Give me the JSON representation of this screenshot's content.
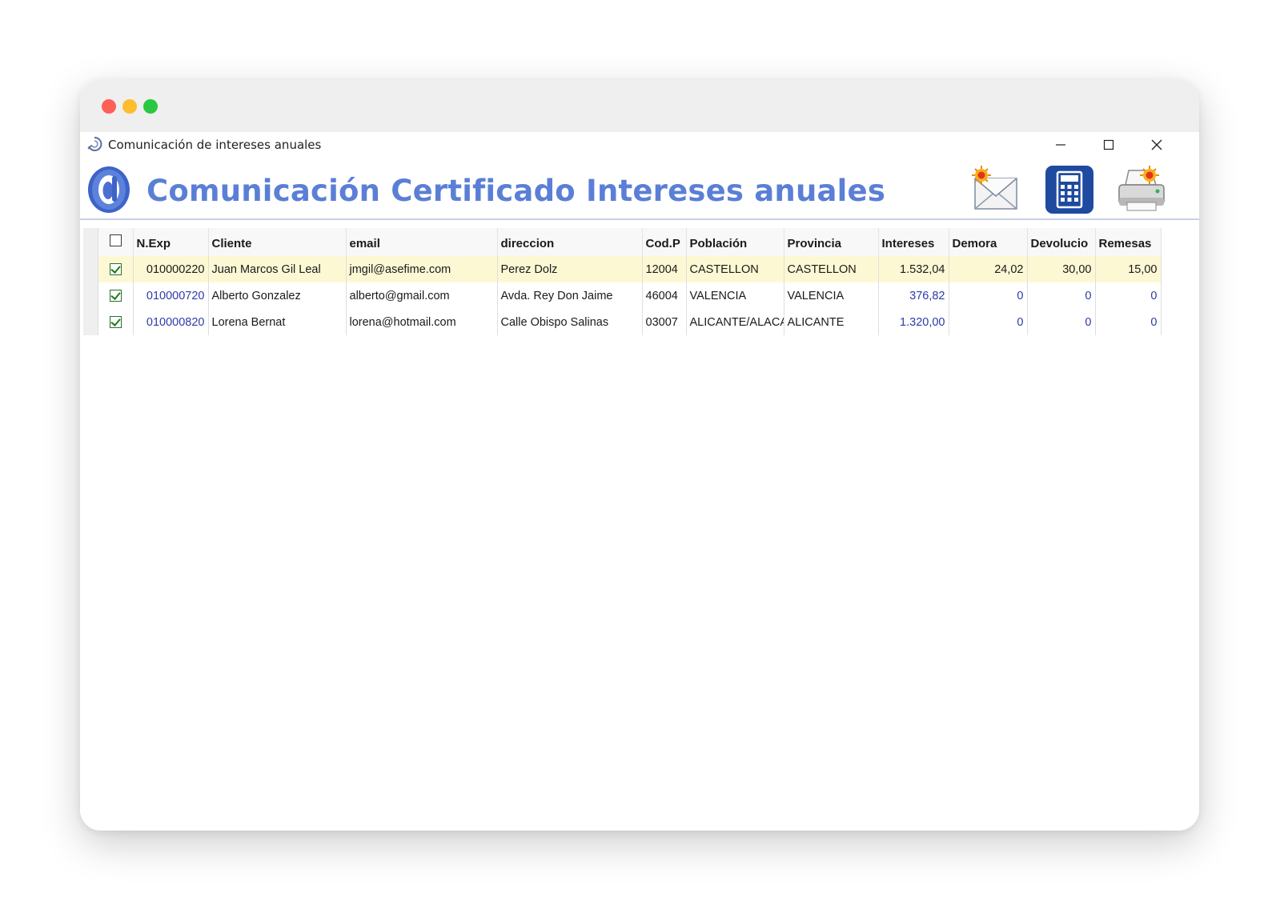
{
  "window": {
    "title": "Comunicación de intereses anuales",
    "heading": "Comunicación Certificado Intereses anuales",
    "minimize_label": "Minimizar",
    "maximize_label": "Maximizar",
    "close_label": "Cerrar"
  },
  "toolbar": {
    "items": [
      {
        "icon": "envelope-send-icon"
      },
      {
        "icon": "calculator-icon"
      },
      {
        "icon": "printer-icon"
      }
    ]
  },
  "colors": {
    "heading": "#5b7fd6",
    "accent_blue": "#1e4aa0",
    "selected_row": "#fdf8d4",
    "link_value": "#2d3ba8"
  },
  "grid": {
    "header_checkbox_checked": false,
    "columns": [
      "N.Exp",
      "Cliente",
      "email",
      "direccion",
      "Cod.P",
      "Población",
      "Provincia",
      "Intereses",
      "Demora",
      "Devolucio",
      "Remesas"
    ],
    "rows": [
      {
        "checked": true,
        "selected": true,
        "cells": [
          "010000220",
          "Juan Marcos Gil Leal",
          "jmgil@asefime.com",
          "Perez Dolz",
          "12004",
          "CASTELLON",
          "CASTELLON",
          "1.532,04",
          "24,02",
          "30,00",
          "15,00"
        ]
      },
      {
        "checked": true,
        "selected": false,
        "cells": [
          "010000720",
          "Alberto Gonzalez",
          "alberto@gmail.com",
          "Avda. Rey Don Jaime",
          "46004",
          "VALENCIA",
          "VALENCIA",
          "376,82",
          "0",
          "0",
          "0"
        ]
      },
      {
        "checked": true,
        "selected": false,
        "cells": [
          "010000820",
          "Lorena Bernat",
          "lorena@hotmail.com",
          "Calle Obispo Salinas",
          "03007",
          "ALICANTE/ALACA",
          "ALICANTE",
          "1.320,00",
          "0",
          "0",
          "0"
        ]
      }
    ]
  }
}
